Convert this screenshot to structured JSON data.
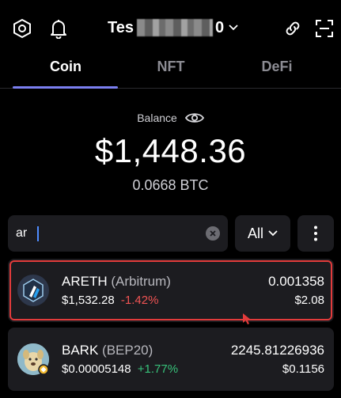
{
  "header": {
    "wallet_name_prefix": "Tes",
    "wallet_name_suffix": "0",
    "settings_icon": "settings-hex-icon",
    "bell_icon": "bell-icon",
    "link_icon": "link-icon",
    "scan_icon": "scan-icon"
  },
  "tabs": [
    {
      "label": "Coin",
      "active": true
    },
    {
      "label": "NFT",
      "active": false
    },
    {
      "label": "DeFi",
      "active": false
    }
  ],
  "balance": {
    "label": "Balance",
    "value": "$1,448.36",
    "btc": "0.0668 BTC"
  },
  "search": {
    "value": "ar",
    "placeholder": ""
  },
  "filter": {
    "selected": "All"
  },
  "tokens": [
    {
      "symbol": "ARETH",
      "network": "(Arbitrum)",
      "price": "$1,532.28",
      "change": "-1.42%",
      "amount": "0.001358",
      "value": "$2.08"
    },
    {
      "symbol": "BARK",
      "network": "(BEP20)",
      "price": "$0.00005148",
      "change": "+1.77%",
      "amount": "2245.81226936",
      "value": "$0.1156"
    }
  ],
  "colors": {
    "accent": "#7b7ff0",
    "negative": "#f05454",
    "positive": "#37c27a",
    "highlight": "#e23b3b"
  }
}
